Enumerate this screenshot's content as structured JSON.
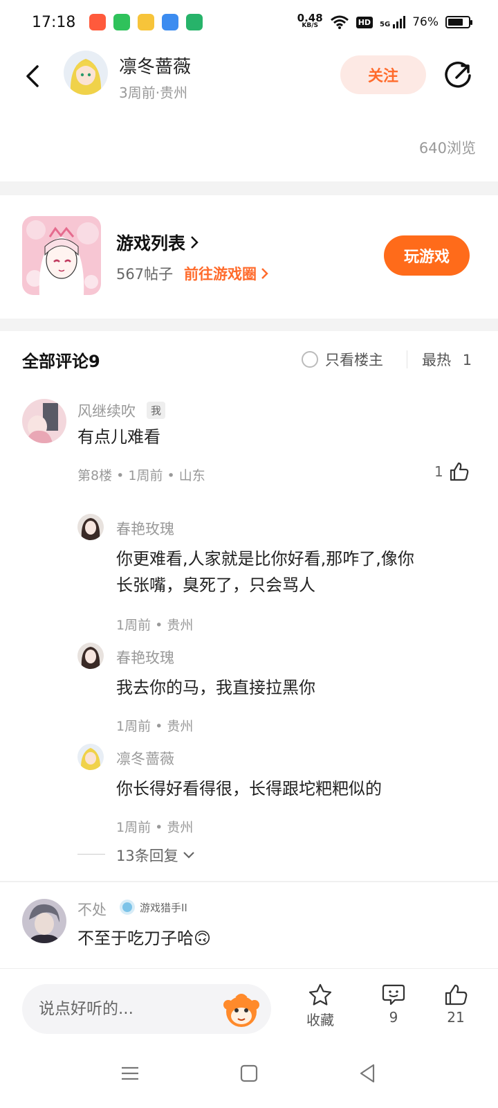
{
  "status_bar": {
    "time": "17:18",
    "net_speed_value": "0.48",
    "net_speed_unit": "KB/S",
    "hd_label": "HD",
    "signal_label": "5G",
    "battery_percent": "76%",
    "battery_level": 0.76
  },
  "header": {
    "author_name": "凛冬蔷薇",
    "author_meta": "3周前·贵州",
    "follow_label": "关注"
  },
  "post": {
    "view_count": "640浏览"
  },
  "game_card": {
    "title": "游戏列表",
    "posts": "567帖子",
    "goto_label": "前往游戏圈",
    "play_label": "玩游戏"
  },
  "comments_header": {
    "title": "全部评论9",
    "owner_only_label": "只看楼主",
    "sort_label": "最热",
    "sort_extra": "1"
  },
  "comments": [
    {
      "name": "风继续吹",
      "tag": "我",
      "text": "有点儿难看",
      "meta": "第8楼 • 1周前 • 山东",
      "likes": "1",
      "replies": [
        {
          "name": "春艳玫瑰",
          "text_line1": "你更难看,人家就是比你好看,那咋了,像你",
          "text_line2": "长张嘴，臭死了，只会骂人",
          "meta": "1周前 • 贵州"
        },
        {
          "name": "春艳玫瑰",
          "text_line1": "我去你的马，我直接拉黑你",
          "meta": "1周前 • 贵州"
        },
        {
          "name": "凛冬蔷薇",
          "text_line1": "你长得好看得很，长得跟坨粑粑似的",
          "meta": "1周前 • 贵州"
        }
      ],
      "more_replies": "13条回复"
    },
    {
      "name": "不处",
      "badge": "游戏猎手II",
      "text": "不至于吃刀子哈",
      "emoji": "🙃"
    }
  ],
  "bottom_bar": {
    "input_placeholder": "说点好听的...",
    "collect_label": "收藏",
    "comment_count": "9",
    "like_count": "21"
  },
  "colors": {
    "accent": "#ff6b1a",
    "follow_bg": "#fde9e4",
    "follow_text": "#ff6b2c",
    "muted": "#999999"
  }
}
